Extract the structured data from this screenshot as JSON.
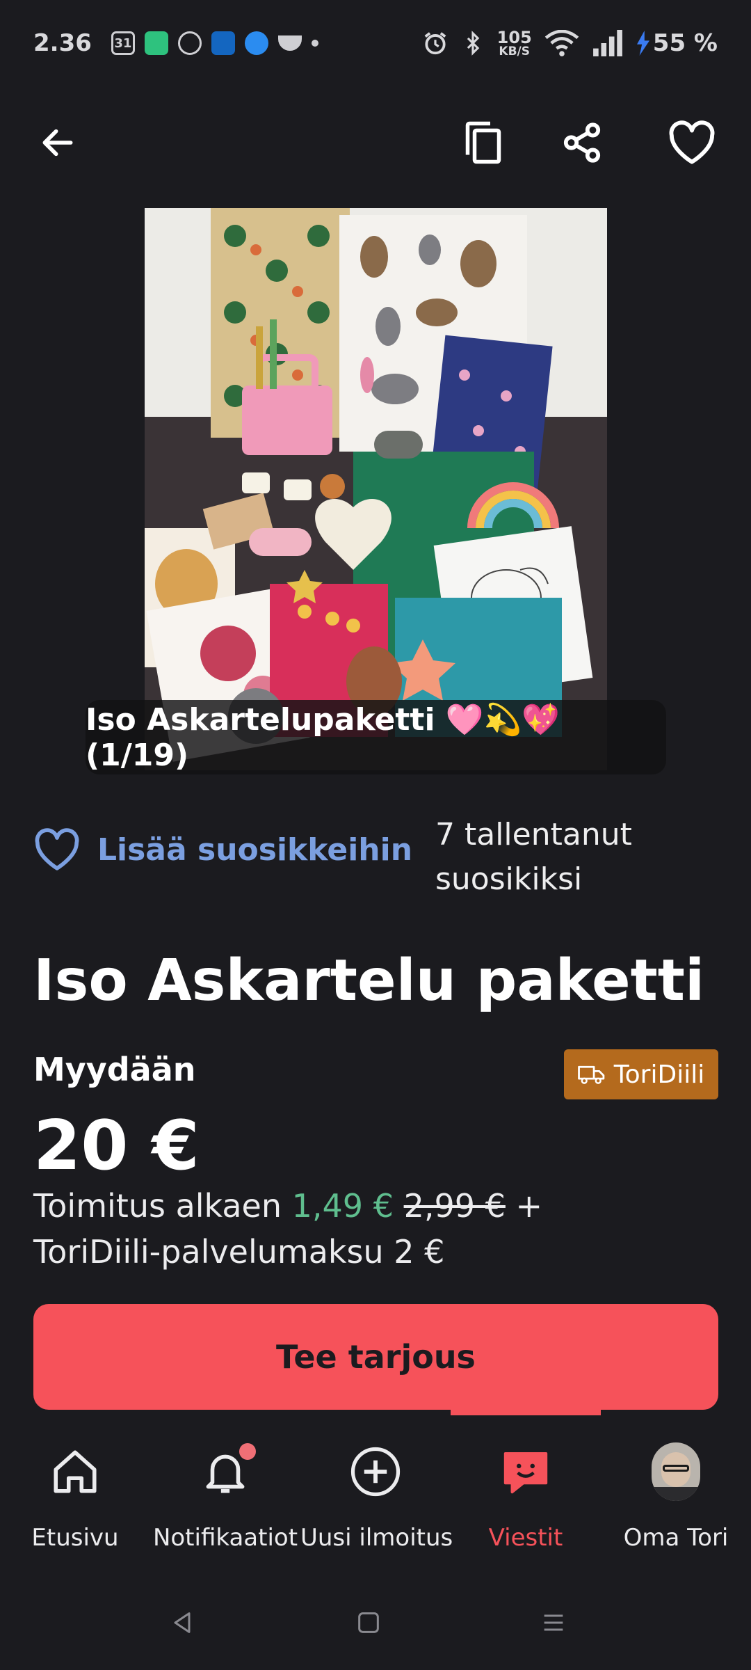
{
  "status_bar": {
    "time": "2.36",
    "calendar_day": "31",
    "net_speed_value": "105",
    "net_speed_unit": "KB/S",
    "battery": "55 %"
  },
  "app_bar": {
    "back_icon": "arrow-left-icon",
    "copy_icon": "copy-icon",
    "share_icon": "share-icon",
    "favorite_icon": "heart-outline-icon"
  },
  "listing": {
    "image_caption": "Iso Askartelupaketti 🩷💫💖 (1/19)",
    "favorite_label": "Lisää suosikkeihin",
    "favorite_count_text": "7 tallentanut suosikiksi",
    "title": "Iso Askartelu paketti",
    "sale_type": "Myydään",
    "badge_label": "ToriDiili",
    "price": "20 €",
    "shipping_prefix": "Toimitus alkaen",
    "shipping_price": "1,49 €",
    "shipping_old_price": "2,99 €",
    "shipping_plus": "+",
    "service_fee": "ToriDiili-palvelumaksu 2 €",
    "offer_button": "Tee tarjous"
  },
  "bottom_nav": {
    "items": [
      {
        "label": "Etusivu",
        "icon": "home-icon"
      },
      {
        "label": "Notifikaatiot",
        "icon": "bell-icon"
      },
      {
        "label": "Uusi ilmoitus",
        "icon": "plus-circle-icon"
      },
      {
        "label": "Viestit",
        "icon": "chat-icon",
        "active": true
      },
      {
        "label": "Oma Tori",
        "icon": "avatar"
      }
    ]
  },
  "colors": {
    "background": "#1b1b1f",
    "accent_red": "#f6525a",
    "link_blue": "#7b9fe0",
    "green_price": "#5fbe8e",
    "badge_orange": "#b46a1d"
  }
}
